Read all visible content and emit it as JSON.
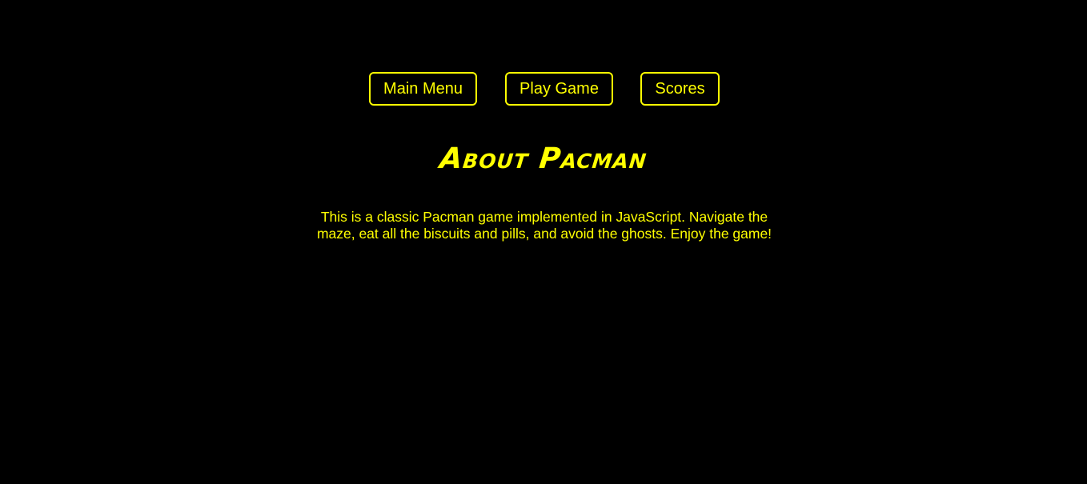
{
  "nav": {
    "main_menu_label": "Main Menu",
    "play_game_label": "Play Game",
    "scores_label": "Scores"
  },
  "about": {
    "title": "About Pacman",
    "description": "This is a classic Pacman game implemented in JavaScript. Navigate the maze, eat all the biscuits and pills, and avoid the ghosts. Enjoy the game!"
  },
  "colors": {
    "background": "#000000",
    "accent": "#ffff00"
  }
}
